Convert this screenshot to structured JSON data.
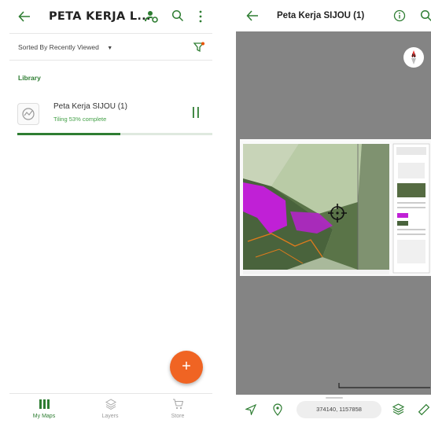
{
  "left_screen": {
    "header": {
      "title": "PETA KERJA L...",
      "icons": [
        "back-arrow-icon",
        "person-settings-icon",
        "search-icon",
        "more-vert-icon"
      ]
    },
    "sort": {
      "label": "Sorted By Recently Viewed",
      "icon": "chevron-down-icon",
      "filter_icon": "filter-icon"
    },
    "library": {
      "header": "Library",
      "items": [
        {
          "title": "Peta Kerja SIJOU (1)",
          "status": "Tiling 53% complete",
          "progress": 0.53,
          "action_icon": "pause-icon"
        }
      ]
    },
    "fab": {
      "label": "+",
      "color": "#f06423"
    },
    "bottom_nav": [
      {
        "label": "My Maps",
        "icon": "maps-icon",
        "active": true
      },
      {
        "label": "Layers",
        "icon": "layers-icon",
        "active": false
      },
      {
        "label": "Store",
        "icon": "cart-icon",
        "active": false
      }
    ]
  },
  "right_screen": {
    "header": {
      "title": "Peta Kerja SIJOU (1)",
      "icons": [
        "back-arrow-icon",
        "info-icon",
        "search-icon"
      ]
    },
    "compass": {
      "label": "N"
    },
    "bottom_bar": {
      "coordinates": "374140, 1157858",
      "icons": [
        "navigation-arrow-icon",
        "location-pin-icon",
        "layers-icon",
        "measure-icon"
      ]
    }
  },
  "colors": {
    "accent": "#2e7d32",
    "fab": "#f06423",
    "map_bg": "#848484"
  }
}
